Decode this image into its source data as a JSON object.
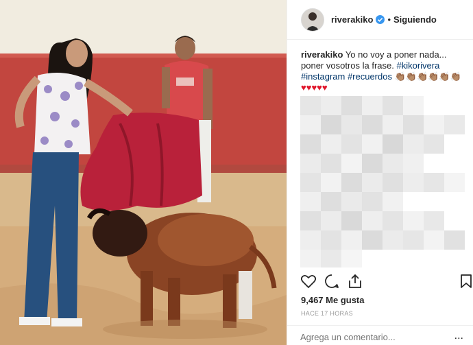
{
  "post": {
    "username": "riverakiko",
    "follow_status": "Siguiendo",
    "separator": "•",
    "caption": {
      "user": "riverakiko",
      "text": "Yo no voy a poner nada... poner vosotros la frase.",
      "hashtags": [
        "#kikorivera",
        "#instagram",
        "#recuerdos"
      ],
      "emojis": "👏🏽👏🏽👏🏽👏🏽👏🏽👏🏽"
    },
    "likes": "9,467 Me gusta",
    "timestamp": "HACE 17 HORAS",
    "comment_placeholder": "Agrega un comentario...",
    "more_label": "..."
  },
  "icons": [
    "verified-icon",
    "heart-icon",
    "comment-icon",
    "share-icon",
    "bookmark-icon"
  ],
  "colors": {
    "accent_link": "#003569",
    "verified_blue": "#3897f0",
    "heart_red": "#e0162b",
    "muted": "#999999"
  }
}
